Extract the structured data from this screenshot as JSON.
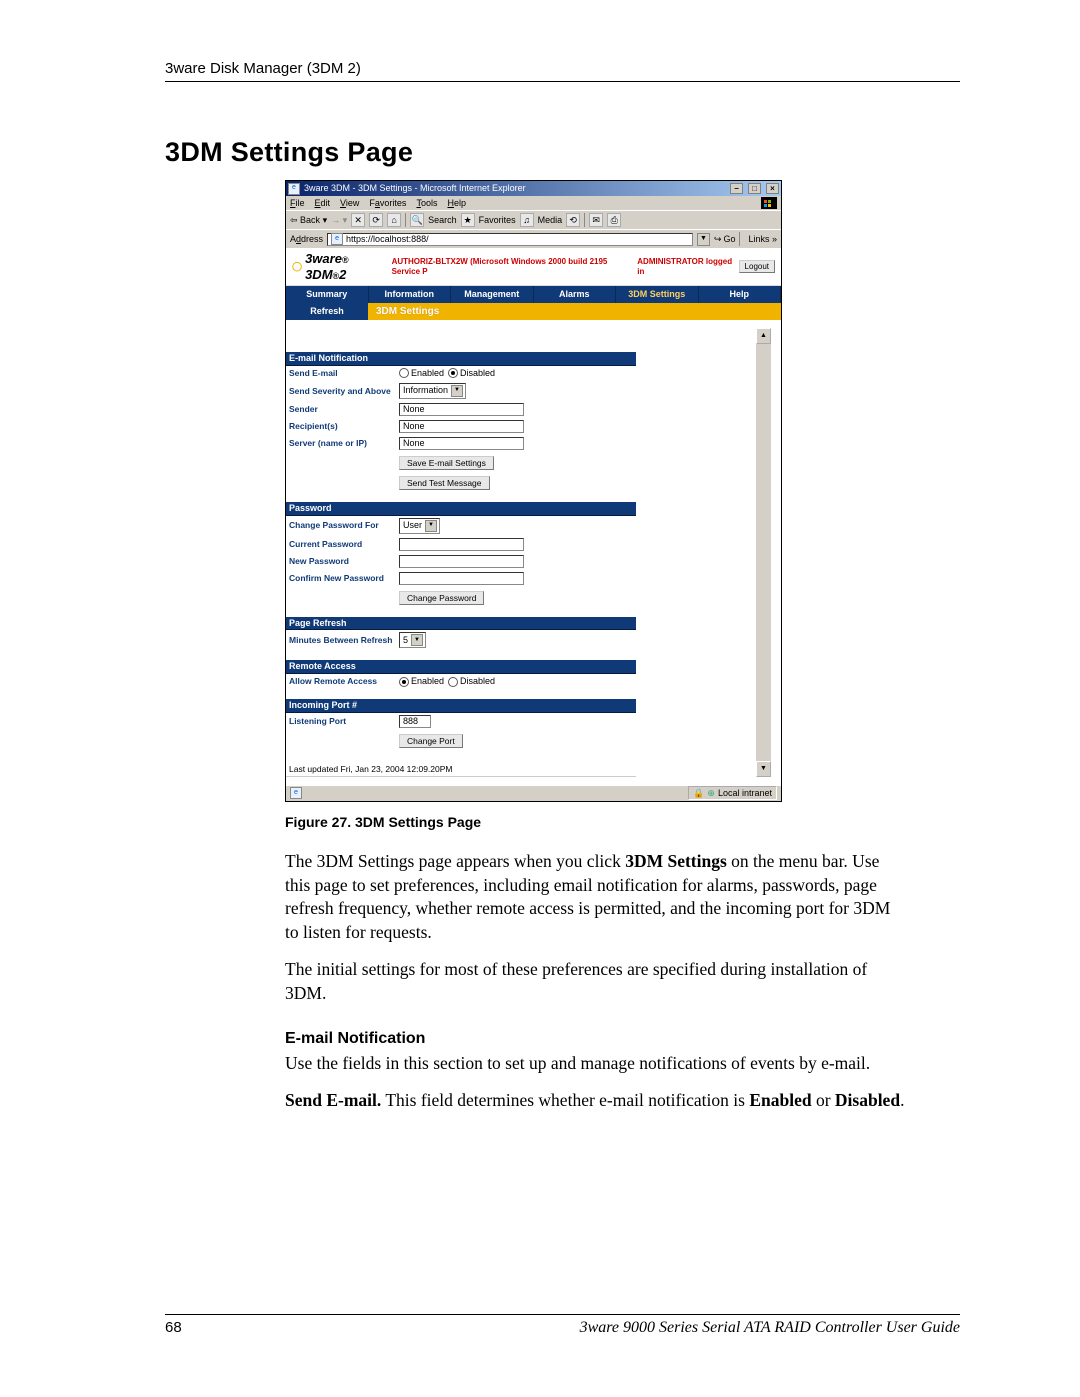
{
  "running_head": "3ware Disk Manager (3DM 2)",
  "page_title": "3DM Settings Page",
  "screenshot": {
    "window_title": "3ware 3DM - 3DM Settings - Microsoft Internet Explorer",
    "menubar": [
      "File",
      "Edit",
      "View",
      "Favorites",
      "Tools",
      "Help"
    ],
    "toolbar": {
      "back": "Back",
      "search": "Search",
      "favorites": "Favorites",
      "media": "Media"
    },
    "addressbar": {
      "label": "Address",
      "url": "https://localhost:888/",
      "go": "Go",
      "links": "Links"
    },
    "brand_prefix": "3ware",
    "brand_name": "3DM",
    "brand_sup": "®",
    "brand_ver": "2",
    "host_info": "AUTHORIZ-BLTX2W (Microsoft Windows 2000 build 2195 Service P",
    "logged_in": "ADMINISTRATOR logged in",
    "logout": "Logout",
    "nav": [
      "Summary",
      "Information",
      "Management",
      "Alarms",
      "3DM Settings",
      "Help"
    ],
    "subnav_refresh": "Refresh",
    "subnav_title": "3DM Settings",
    "sections": {
      "email": {
        "title": "E-mail Notification",
        "send_label": "Send E-mail",
        "enabled": "Enabled",
        "disabled": "Disabled",
        "severity_label": "Send Severity and Above",
        "severity_value": "Information",
        "sender_label": "Sender",
        "sender_value": "None",
        "recipients_label": "Recipient(s)",
        "recipients_value": "None",
        "server_label": "Server (name or IP)",
        "server_value": "None",
        "save_btn": "Save E-mail Settings",
        "test_btn": "Send Test Message"
      },
      "password": {
        "title": "Password",
        "change_for_label": "Change Password For",
        "change_for_value": "User",
        "current_label": "Current Password",
        "new_label": "New Password",
        "confirm_label": "Confirm New Password",
        "change_btn": "Change Password"
      },
      "page_refresh": {
        "title": "Page Refresh",
        "minutes_label": "Minutes Between Refresh",
        "minutes_value": "5"
      },
      "remote": {
        "title": "Remote Access",
        "allow_label": "Allow Remote Access",
        "enabled": "Enabled",
        "disabled": "Disabled"
      },
      "port": {
        "title": "Incoming Port #",
        "listening_label": "Listening Port",
        "listening_value": "888",
        "change_btn": "Change Port"
      }
    },
    "last_updated": "Last updated Fri, Jan 23, 2004 12:09.20PM",
    "statusbar": {
      "zone": "Local intranet"
    }
  },
  "caption": "Figure 27.   3DM Settings Page",
  "para1_a": "The 3DM Settings page appears when you click ",
  "para1_bold": "3DM Settings",
  "para1_b": " on the menu bar. Use this page to set preferences, including email notification for alarms, passwords, page refresh frequency, whether remote access is permitted, and the incoming port for 3DM to listen for requests.",
  "para2": "The initial settings for most of these preferences are specified during installation of 3DM.",
  "subhead_email": "E-mail Notification",
  "para3": "Use the fields in this section to set up and manage notifications of events by e-mail.",
  "para4_bold1": "Send E-mail.",
  "para4_mid": " This field determines whether e-mail notification is ",
  "para4_bold2": "Enabled",
  "para4_or": " or ",
  "para4_bold3": "Disabled",
  "para4_end": ".",
  "page_number": "68",
  "footer_title": "3ware 9000 Series Serial ATA RAID Controller User Guide"
}
